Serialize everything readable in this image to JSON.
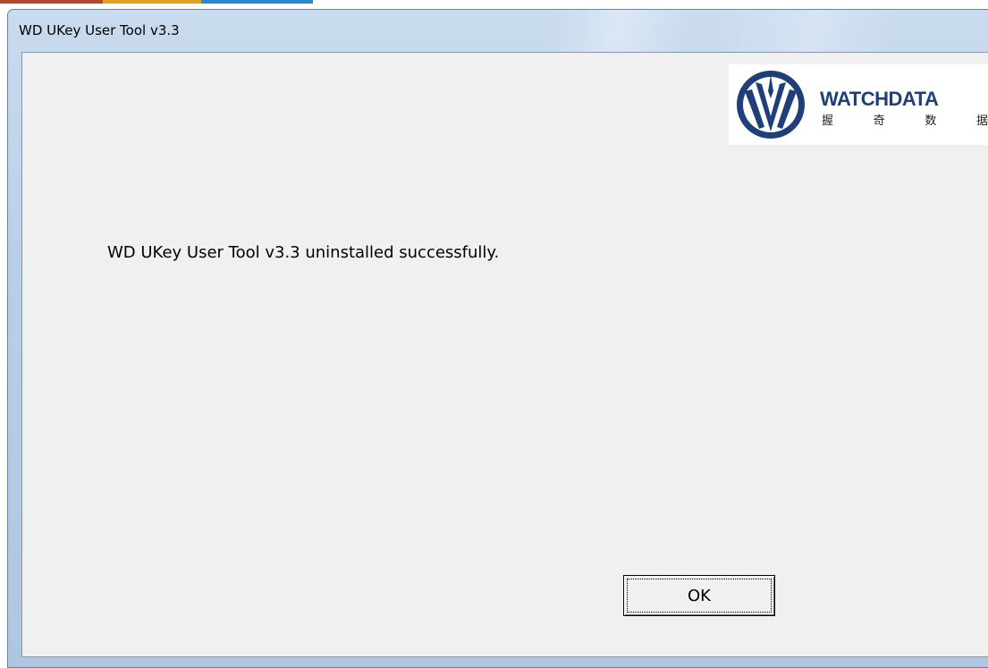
{
  "window": {
    "title": "WD UKey User Tool v3.3"
  },
  "logo": {
    "brand": "WATCHDATA",
    "chinese_chars": [
      "握",
      "奇",
      "数",
      "据"
    ],
    "icon": "watchdata-emblem-icon",
    "color": "#1e3f7a"
  },
  "dialog": {
    "message": "WD UKey User Tool v3.3 uninstalled successfully.",
    "ok_label": "OK"
  },
  "colors": {
    "titlebar": "#b9cfe7",
    "client_bg": "#f0f0f0",
    "strip": [
      "#b0492a",
      "#e1a01d",
      "#2c86d2"
    ]
  }
}
